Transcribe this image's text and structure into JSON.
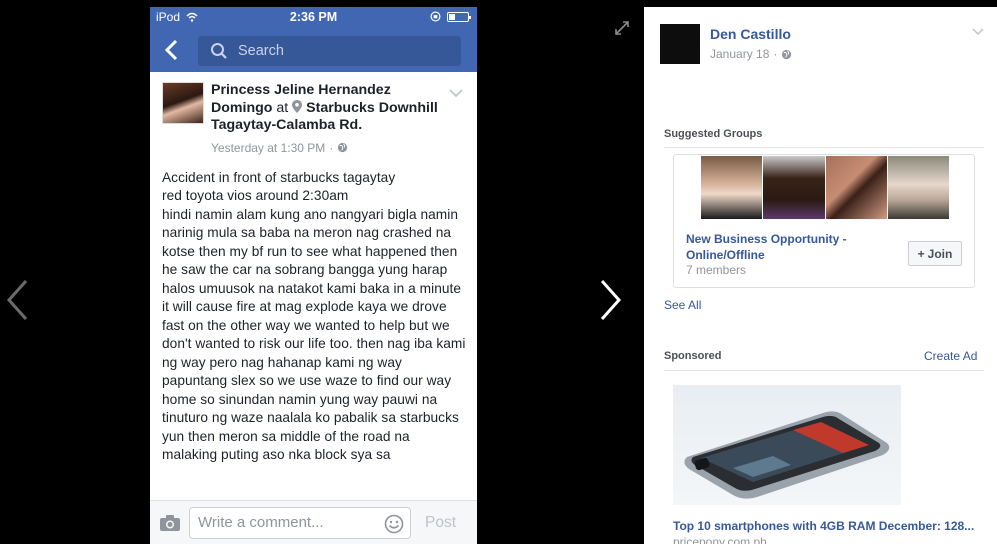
{
  "viewer": {
    "prev_icon": "chevron-left-icon",
    "next_icon": "chevron-right-icon",
    "expand_icon": "expand-icon"
  },
  "phone": {
    "status": {
      "carrier": "iPod",
      "time": "2:36 PM"
    },
    "search_placeholder": "Search",
    "post": {
      "author": "Princess Jeline Hernandez Domingo",
      "at": "at",
      "place": "Starbucks Downhill Tagaytay-Calamba Rd",
      "timestamp": "Yesterday at 1:30 PM",
      "text": "Accident in front of starbucks tagaytay\nred toyota vios around 2:30am\nhindi namin alam kung ano nangyari bigla namin narinig mula sa baba na meron nag crashed na kotse then my bf run to see what happened then he saw the car na sobrang bangga yung harap halos umuusok na natakot kami baka in a minute it will cause fire at mag explode kaya we drove fast on the other way we wanted to help but we don't wanted to risk our life too. then nag iba kami ng way pero nag hahanap kami ng way papuntang slex so we use waze to find our way home so sinundan namin yung way pauwi na tinuturo ng waze naalala ko pabalik sa starbucks yun then meron sa middle of the road na malaking puting aso nka block sya sa"
    },
    "comment_placeholder": "Write a comment...",
    "post_button": "Post"
  },
  "sidebar": {
    "owner_name": "Den Castillo",
    "owner_date": "January 18",
    "suggested_title": "Suggested Groups",
    "group": {
      "name": "New Business Opportunity - Online/Offline",
      "members": "7 members",
      "join_label": "Join"
    },
    "see_all": "See All",
    "sponsored_title": "Sponsored",
    "create_ad": "Create Ad",
    "ad": {
      "title": "Top 10 smartphones with 4GB RAM December: 128...",
      "domain": "pricepony.com.ph"
    }
  },
  "colors": {
    "fb_blue": "#4267b2",
    "link_blue": "#365899",
    "muted": "#90949c"
  }
}
